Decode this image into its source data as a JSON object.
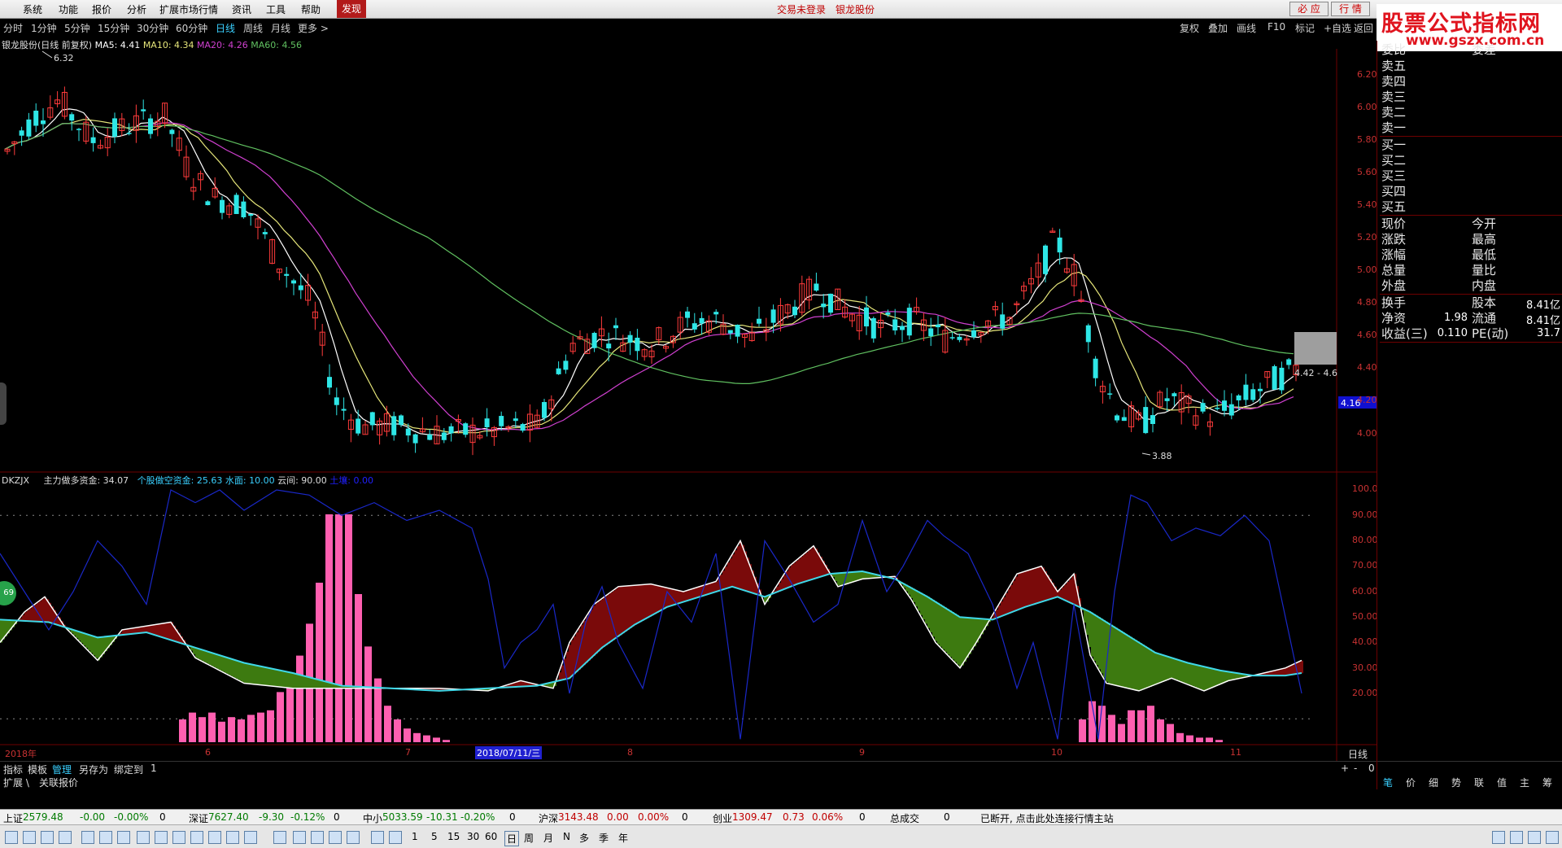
{
  "menubar": {
    "items": [
      "系统",
      "功能",
      "报价",
      "分析",
      "扩展市场行情",
      "资讯",
      "工具",
      "帮助"
    ],
    "find_label": "发现",
    "login_status": "交易未登录",
    "stock_name": "银龙股份",
    "btn_biying": "必 应",
    "btn_hangqing": "行 情"
  },
  "logo": {
    "title": "股票公式指标网",
    "url": "www.gszx.com.cn"
  },
  "periodbar": {
    "items": [
      "分时",
      "1分钟",
      "5分钟",
      "15分钟",
      "30分钟",
      "60分钟",
      "日线",
      "周线",
      "月线",
      "更多 >"
    ],
    "active": "日线"
  },
  "toolbar_right": [
    "复权",
    "叠加",
    "画线",
    "F10",
    "标记",
    "+自选",
    "返回"
  ],
  "main_chart": {
    "title": "银龙股份(日线 前复权)",
    "ma5": "MA5: 4.41",
    "ma10": "MA10: 4.34",
    "ma20": "MA20: 4.26",
    "ma60": "MA60: 4.56",
    "high_label": "6.32",
    "low_label": "3.88",
    "range_label": "4.42 - 4.6",
    "current_price_tag": "4.16",
    "y_ticks": [
      "6.20",
      "6.00",
      "5.80",
      "5.60",
      "5.40",
      "5.20",
      "5.00",
      "4.80",
      "4.60",
      "4.40",
      "4.20",
      "4.00"
    ],
    "colors": {
      "up": "#ff3b3b",
      "down": "#2ee6e6",
      "ma5": "#ffffff",
      "ma10": "#e6e67a",
      "ma20": "#d040d0",
      "ma60": "#60c060"
    }
  },
  "sub_chart": {
    "name": "DKZJX",
    "l1": "主力做多资金: 34.07",
    "l2": "个股做空资金: 25.63",
    "l3": "水面: 10.00",
    "l4": "云间: 90.00",
    "l5": "土壤: 0.00",
    "y_ticks": [
      "100.0",
      "90.00",
      "80.00",
      "70.00",
      "60.00",
      "50.00",
      "40.00",
      "30.00",
      "20.00"
    ],
    "badge": "69"
  },
  "time_axis": {
    "labels": [
      "2018年",
      "6",
      "7",
      "8",
      "9",
      "10",
      "11"
    ],
    "cursor_date": "2018/07/11/三",
    "period": "日线"
  },
  "tabs_bottom": {
    "items": [
      "指标",
      "模板",
      "管理",
      "另存为",
      "绑定到",
      "1"
    ],
    "active": "管理",
    "expand": "扩展 \\",
    "related": "关联报价",
    "right_ctrls": [
      "+",
      "-",
      "0"
    ]
  },
  "right_panel": {
    "sell_header": [
      "委比",
      "委差"
    ],
    "sell": [
      "卖五",
      "卖四",
      "卖三",
      "卖二",
      "卖一"
    ],
    "buy": [
      "买一",
      "买二",
      "买三",
      "买四",
      "买五"
    ],
    "stats_left": [
      "现价",
      "涨跌",
      "涨幅",
      "总量",
      "外盘"
    ],
    "stats_right": [
      "今开",
      "最高",
      "最低",
      "量比",
      "内盘"
    ],
    "fin_rows": [
      {
        "l": "换手",
        "lv": "",
        "r": "股本",
        "rv": "8.41亿"
      },
      {
        "l": "净资",
        "lv": "1.98",
        "r": "流通",
        "rv": "8.41亿"
      },
      {
        "l": "收益(三)",
        "lv": "0.110",
        "r": "PE(动)",
        "rv": "31.7"
      }
    ],
    "tabs": [
      "笔",
      "价",
      "细",
      "势",
      "联",
      "值",
      "主",
      "筹"
    ]
  },
  "index_bar": [
    {
      "name": "上证",
      "value": "2579.48",
      "chg": "-0.00",
      "pct": "-0.00%",
      "vol": "0",
      "dir": "neg"
    },
    {
      "name": "深证",
      "value": "7627.40",
      "chg": "-9.30",
      "pct": "-0.12%",
      "vol": "0",
      "dir": "neg"
    },
    {
      "name": "中小",
      "value": "5033.59",
      "chg": "-10.31",
      "pct": "-0.20%",
      "vol": "0",
      "dir": "neg"
    },
    {
      "name": "沪深",
      "value": "3143.48",
      "chg": "0.00",
      "pct": "0.00%",
      "vol": "0",
      "dir": "pos"
    },
    {
      "name": "创业",
      "value": "1309.47",
      "chg": "0.73",
      "pct": "0.06%",
      "vol": "0",
      "dir": "pos"
    }
  ],
  "total_trade": {
    "label": "总成交",
    "value": "0"
  },
  "connection_msg": "已断开, 点击此处连接行情主站",
  "icon_bar_text": [
    "1",
    "5",
    "15",
    "30",
    "60",
    "日",
    "周",
    "月",
    "N",
    "多",
    "季",
    "年"
  ]
}
